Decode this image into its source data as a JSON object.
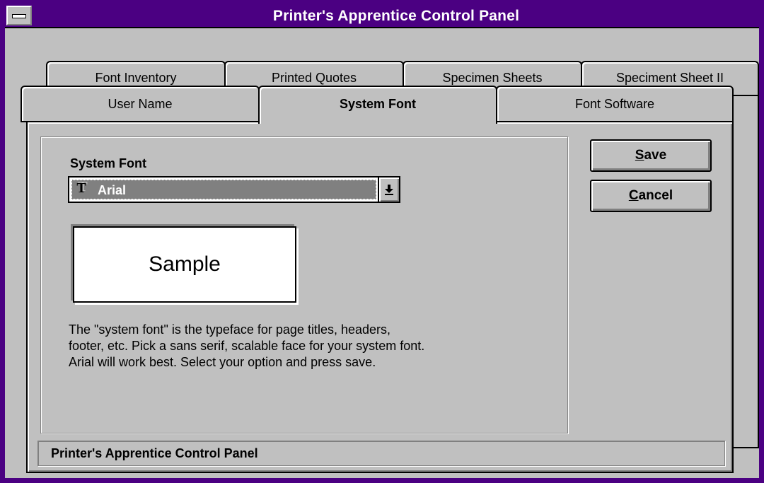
{
  "window": {
    "title": "Printer's Apprentice Control Panel"
  },
  "tabs": {
    "back_row": [
      {
        "label": "Font Inventory"
      },
      {
        "label": "Printed Quotes"
      },
      {
        "label": "Specimen Sheets"
      },
      {
        "label": "Speciment Sheet II"
      }
    ],
    "front_row": [
      {
        "label": "User Name"
      },
      {
        "label": "System Font"
      },
      {
        "label": "Font Software"
      }
    ],
    "active": "System Font"
  },
  "system_font": {
    "label": "System Font",
    "selected": "Arial",
    "font_type_icon": "truetype-icon",
    "dropdown_icon": "down-arrow-icon",
    "sample_text": "Sample",
    "description": [
      "The \"system font\" is the typeface for page titles, headers,",
      "footer, etc. Pick a sans serif, scalable face for your system font.",
      "Arial will work best. Select your option and press save."
    ]
  },
  "buttons": {
    "save_prefix": "S",
    "save_rest": "ave",
    "cancel_prefix": "C",
    "cancel_rest": "ancel"
  },
  "status": {
    "text": "Printer's Apprentice Control Panel"
  },
  "colors": {
    "title_bar": "#4b0082",
    "face": "#c0c0c0",
    "selection": "#808080"
  }
}
